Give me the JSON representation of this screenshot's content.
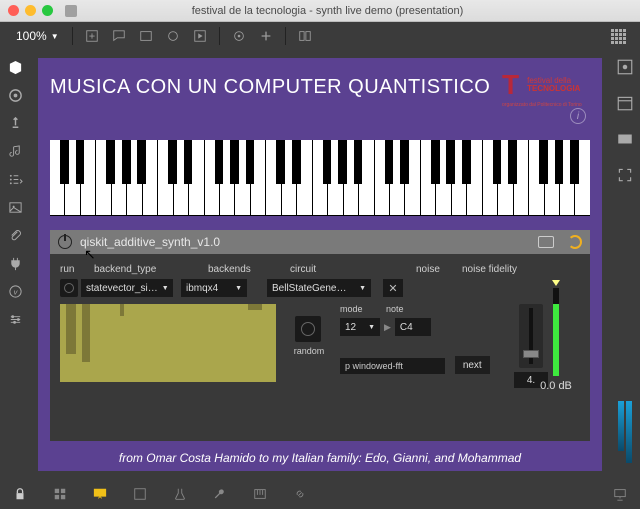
{
  "window": {
    "title": "festival de la tecnologia - synth live demo (presentation)"
  },
  "toolbar": {
    "zoom": "100%"
  },
  "slide": {
    "title": "MUSICA CON UN COMPUTER QUANTISTICO",
    "brand_line1": "festival della",
    "brand_line2": "TECNOLOGIA",
    "brand_sub": "organizzato dal Politecnico di Torino",
    "credit": "from Omar Costa Hamido to my Italian family: Edo, Gianni, and Mohammad"
  },
  "synth": {
    "name": "qiskit_additive_synth_v1.0",
    "labels": {
      "run": "run",
      "backend_type": "backend_type",
      "backends": "backends",
      "circuit": "circuit",
      "noise": "noise",
      "noise_fidelity": "noise fidelity",
      "mode": "mode",
      "note": "note",
      "random": "random",
      "next": "next"
    },
    "values": {
      "backend_type": "statevector_si…",
      "backend": "ibmqx4",
      "circuit": "BellStateGene…",
      "mode": "12",
      "note": "C4",
      "algorithm": "p windowed-fft",
      "noise_fidelity": "4.",
      "level_db": "0.0 dB"
    }
  }
}
